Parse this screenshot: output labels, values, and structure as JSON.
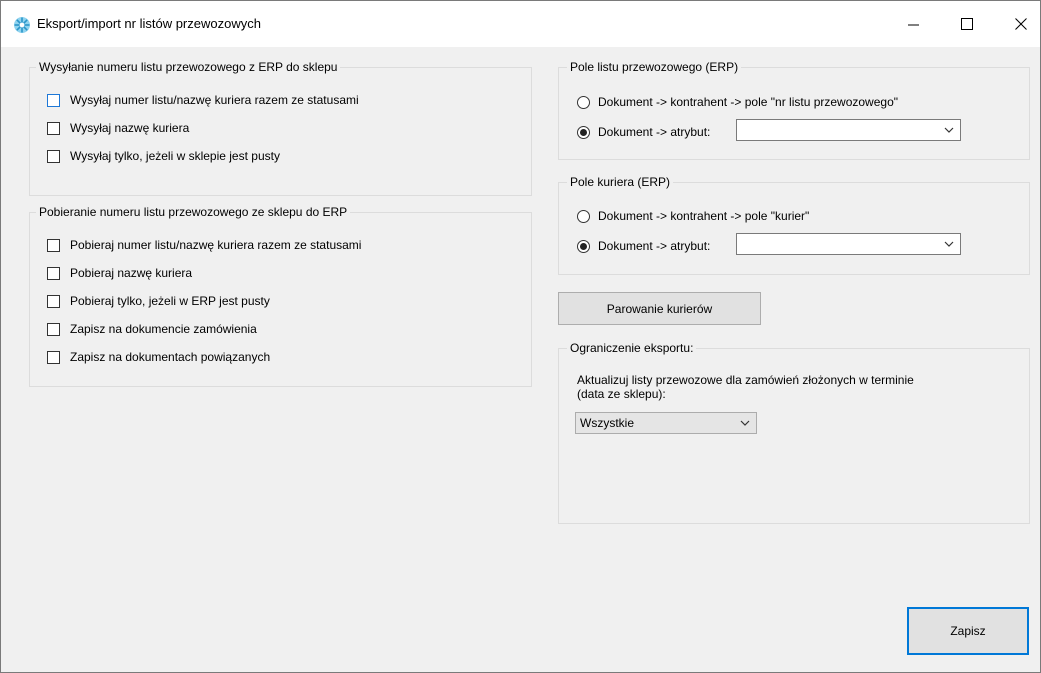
{
  "window": {
    "title": "Eksport/import nr listów przewozowych",
    "controls": {
      "minimize_icon": "minimize-icon",
      "maximize_icon": "maximize-icon",
      "close_icon": "close-icon"
    }
  },
  "send_group": {
    "title": "Wysyłanie numeru listu przewozowego z ERP do sklepu",
    "options": [
      {
        "label": "Wysyłaj numer listu/nazwę kuriera razem ze statusami",
        "checked": false
      },
      {
        "label": "Wysyłaj nazwę kuriera",
        "checked": false
      },
      {
        "label": "Wysyłaj tylko, jeżeli w sklepie jest pusty",
        "checked": false
      }
    ]
  },
  "fetch_group": {
    "title": "Pobieranie numeru listu przewozowego ze sklepu do ERP",
    "options": [
      {
        "label": "Pobieraj numer listu/nazwę kuriera razem ze statusami",
        "checked": false
      },
      {
        "label": "Pobieraj nazwę kuriera",
        "checked": false
      },
      {
        "label": "Pobieraj tylko, jeżeli w ERP jest pusty",
        "checked": false
      },
      {
        "label": "Zapisz na dokumencie zamówienia",
        "checked": false
      },
      {
        "label": "Zapisz na dokumentach powiązanych",
        "checked": false
      }
    ]
  },
  "waybill_field_group": {
    "title": "Pole listu przewozowego (ERP)",
    "radio_contractor": "Dokument -> kontrahent -> pole \"nr listu przewozowego\"",
    "radio_attribute": "Dokument -> atrybut:",
    "selected": "attribute",
    "attribute_value": ""
  },
  "courier_field_group": {
    "title": "Pole kuriera (ERP)",
    "radio_contractor": "Dokument -> kontrahent -> pole \"kurier\"",
    "radio_attribute": "Dokument -> atrybut:",
    "selected": "attribute",
    "attribute_value": ""
  },
  "courier_pairing_button": "Parowanie kurierów",
  "export_limit_group": {
    "title": "Ograniczenie eksportu:",
    "description_line1": "Aktualizuj listy przewozowe dla zamówień złożonych w terminie",
    "description_line2": "(data ze sklepu):",
    "period_selected": "Wszystkie"
  },
  "save_button": "Zapisz",
  "colors": {
    "accent": "#0078d7",
    "background": "#f0f0f0",
    "titlebar": "#ffffff"
  }
}
